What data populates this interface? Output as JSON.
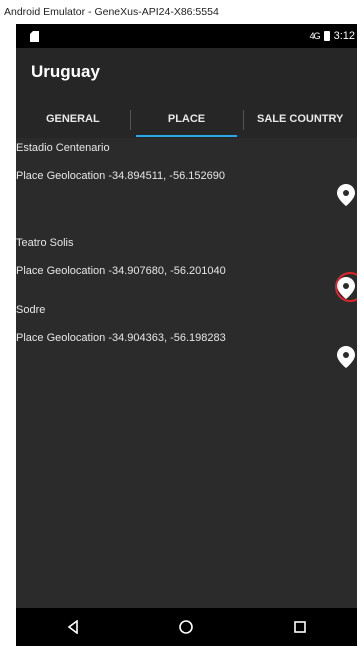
{
  "window": {
    "title": "Android Emulator - GeneXus-API24-X86:5554"
  },
  "status_bar": {
    "time": "3:12",
    "signal": "4G"
  },
  "app_bar": {
    "title": "Uruguay"
  },
  "tabs": [
    {
      "label": "GENERAL",
      "active": false
    },
    {
      "label": "PLACE",
      "active": true
    },
    {
      "label": "SALE COUNTRY",
      "active": false
    }
  ],
  "places": [
    {
      "name": "Estadio Centenario",
      "geolocation": "Place Geolocation -34.894511, -56.152690",
      "highlighted": false
    },
    {
      "name": "Teatro Solis",
      "geolocation": "Place Geolocation -34.907680, -56.201040",
      "highlighted": true
    },
    {
      "name": "Sodre",
      "geolocation": "Place Geolocation -34.904363, -56.198283",
      "highlighted": false
    }
  ],
  "icons": {
    "location_pin": "map-pin-icon",
    "back": "back-triangle-icon",
    "home": "home-circle-icon",
    "recents": "recents-square-icon"
  },
  "colors": {
    "accent": "#29a5e8",
    "highlight_ring": "#e0242a",
    "background": "#2b2b2b"
  }
}
